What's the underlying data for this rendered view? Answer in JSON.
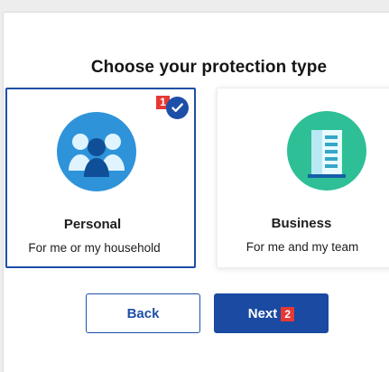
{
  "dialog": {
    "title": "Choose your protection type"
  },
  "cards": {
    "personal": {
      "title": "Personal",
      "description": "For me or my household",
      "step_badge": "1",
      "selected": true,
      "icon": "family-icon",
      "icon_color": "#2f93da"
    },
    "business": {
      "title": "Business",
      "description": "For me and my team",
      "icon": "building-icon",
      "icon_color": "#2ebf96"
    }
  },
  "buttons": {
    "back_label": "Back",
    "next_label": "Next",
    "next_step_badge": "2"
  },
  "colors": {
    "accent": "#1d4fa8",
    "badge": "#e53935"
  }
}
